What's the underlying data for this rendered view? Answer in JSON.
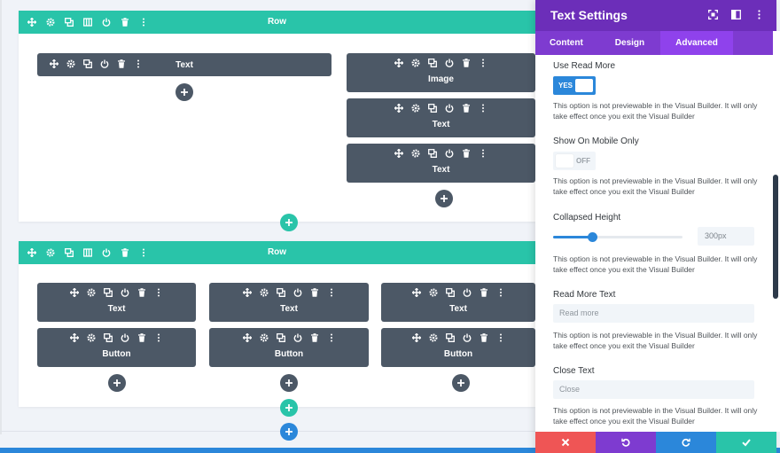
{
  "builder": {
    "sections": [
      {
        "row_label": "Row",
        "columns_left": [
          {
            "title": "Text"
          }
        ],
        "columns_right": [
          {
            "title": "Image"
          },
          {
            "title": "Text"
          },
          {
            "title": "Text"
          }
        ]
      },
      {
        "row_label": "Row",
        "columns": [
          [
            {
              "title": "Text"
            },
            {
              "title": "Button"
            }
          ],
          [
            {
              "title": "Text"
            },
            {
              "title": "Button"
            }
          ],
          [
            {
              "title": "Text"
            },
            {
              "title": "Button"
            }
          ]
        ]
      }
    ],
    "row_toolbar_icons": [
      "move-icon",
      "gear-icon",
      "duplicate-icon",
      "columns-icon",
      "power-icon",
      "trash-icon",
      "more-icon"
    ],
    "module_toolbar_icons": [
      "move-icon",
      "gear-icon",
      "duplicate-icon",
      "power-icon",
      "trash-icon",
      "more-icon"
    ],
    "colors": {
      "row_bar": "#29c4a9",
      "module": "#4c5866",
      "accent_blue": "#2b87da"
    }
  },
  "panel": {
    "title": "Text Settings",
    "header_icons": [
      "expand-icon",
      "sidebar-icon",
      "more-icon"
    ],
    "tabs": [
      {
        "label": "Content",
        "active": false
      },
      {
        "label": "Design",
        "active": false
      },
      {
        "label": "Advanced",
        "active": true
      }
    ],
    "fields": {
      "use_read_more": {
        "label": "Use Read More",
        "toggle_text": "YES",
        "on": true,
        "note": "This option is not previewable in the Visual Builder. It will only take effect once you exit the Visual Builder"
      },
      "show_on_mobile_only": {
        "label": "Show On Mobile Only",
        "toggle_text": "OFF",
        "on": false,
        "note": "This option is not previewable in the Visual Builder. It will only take effect once you exit the Visual Builder"
      },
      "collapsed_height": {
        "label": "Collapsed Height",
        "value": "300px",
        "slider_fraction": 0.3,
        "note": "This option is not previewable in the Visual Builder. It will only take effect once you exit the Visual Builder"
      },
      "read_more_text": {
        "label": "Read More Text",
        "placeholder": "Read more",
        "note": "This option is not previewable in the Visual Builder. It will only take effect once you exit the Visual Builder"
      },
      "close_text": {
        "label": "Close Text",
        "placeholder": "Close",
        "note": "This option is not previewable in the Visual Builder. It will only take effect once you exit the Visual Builder"
      }
    },
    "footer": [
      {
        "action": "discard",
        "icon": "close-icon",
        "color": "#ef5555"
      },
      {
        "action": "undo",
        "icon": "undo-icon",
        "color": "#7e3bd0"
      },
      {
        "action": "redo",
        "icon": "redo-icon",
        "color": "#2b87da"
      },
      {
        "action": "save",
        "icon": "check-icon",
        "color": "#29c4a9"
      }
    ],
    "colors": {
      "header": "#6c2eb9",
      "tabs": "#7e3bd0",
      "tab_active": "#8f42ec"
    }
  }
}
